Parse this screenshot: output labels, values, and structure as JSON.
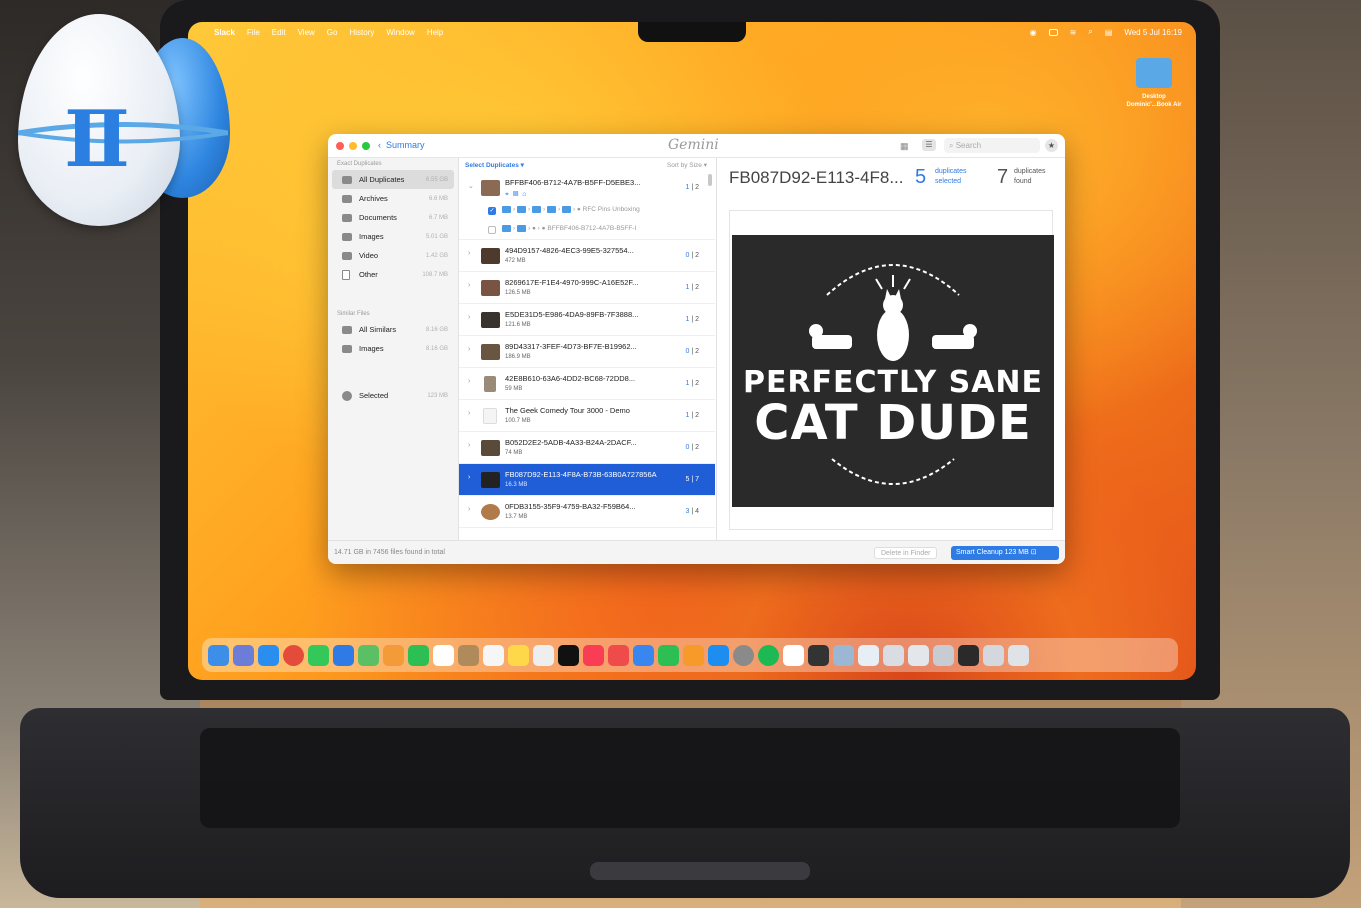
{
  "menubar": {
    "apple": "",
    "app": "Slack",
    "items": [
      "File",
      "Edit",
      "View",
      "Go",
      "History",
      "Window",
      "Help"
    ],
    "datetime": "Wed 5 Jul  16:19"
  },
  "desktop": {
    "icon_label": "Desktop\nDominic'...Book Air"
  },
  "window": {
    "back_label": "Summary",
    "app_title": "Gemini",
    "search_placeholder": "Search"
  },
  "sidebar": {
    "exact_header": "Exact Duplicates",
    "exact_items": [
      {
        "label": "All Duplicates",
        "size": "6.55 GB",
        "icon": "duplicates-icon"
      },
      {
        "label": "Archives",
        "size": "6.6 MB",
        "icon": "archive-icon"
      },
      {
        "label": "Documents",
        "size": "6.7 MB",
        "icon": "documents-icon"
      },
      {
        "label": "Images",
        "size": "5.01 GB",
        "icon": "images-icon"
      },
      {
        "label": "Video",
        "size": "1.42 GB",
        "icon": "video-icon"
      },
      {
        "label": "Other",
        "size": "108.7 MB",
        "icon": "other-icon"
      }
    ],
    "similar_header": "Similar Files",
    "similar_items": [
      {
        "label": "All Similars",
        "size": "8.16 GB",
        "icon": "similars-icon"
      },
      {
        "label": "Images",
        "size": "8.16 GB",
        "icon": "images-icon"
      }
    ],
    "selected": {
      "label": "Selected",
      "size": "123 MB",
      "icon": "selected-icon"
    }
  },
  "list": {
    "select_label": "Select Duplicates",
    "sort_label": "Sort by Size",
    "first": {
      "name": "BFFBF406-B712-4A7B-B5FF-D5EBE3...",
      "count_sel": "1",
      "count_total": "2",
      "sub": [
        {
          "checked": true,
          "path": "RFC Pins Unboxing"
        },
        {
          "checked": false,
          "path": "BFFBF406-B712-4A7B-B5FF-I"
        }
      ]
    },
    "rows": [
      {
        "name": "494D9157-4826-4EC3-99E5-327554...",
        "size": "472 MB",
        "sel": "0",
        "total": "2"
      },
      {
        "name": "8269617E-F1E4-4970-999C-A16E52F...",
        "size": "126.5 MB",
        "sel": "1",
        "total": "2"
      },
      {
        "name": "E5DE31D5-E986-4DA9-89FB-7F3888...",
        "size": "121.6 MB",
        "sel": "1",
        "total": "2"
      },
      {
        "name": "89D43317-3FEF-4D73-BF7E-B19962...",
        "size": "186.9 MB",
        "sel": "0",
        "total": "2"
      },
      {
        "name": "42E8B610-63A6-4DD2-BC68-72DD8...",
        "size": "59 MB",
        "sel": "1",
        "total": "2"
      },
      {
        "name": "The Geek Comedy Tour 3000 - Demo",
        "size": "100.7 MB",
        "sel": "1",
        "total": "2"
      },
      {
        "name": "B052D2E2-5ADB-4A33-B24A-2DACF...",
        "size": "74 MB",
        "sel": "0",
        "total": "2"
      },
      {
        "name": "FB087D92-E113-4F8A-B73B-63B0A727856A",
        "size": "16.3 MB",
        "sel": "5",
        "total": "7"
      },
      {
        "name": "0FDB3155-35F9-4759-BA32-F59B64...",
        "size": "13.7 MB",
        "sel": "3",
        "total": "4"
      }
    ]
  },
  "detail": {
    "title": "FB087D92-E113-4F8...",
    "dup_selected_num": "5",
    "dup_selected_label": "duplicates\nselected",
    "dup_found_num": "7",
    "dup_found_label": "duplicates\nfound",
    "preview_line1": "PERFECTLY SANE",
    "preview_line2": "CAT DUDE"
  },
  "footer": {
    "info": "14.71 GB in 7456 files found in total",
    "delete_label": "Delete in Finder",
    "smart_label": "Smart Cleanup 123 MB"
  },
  "colors": {
    "accent": "#2f7be6",
    "selection": "#1f5ed6"
  }
}
